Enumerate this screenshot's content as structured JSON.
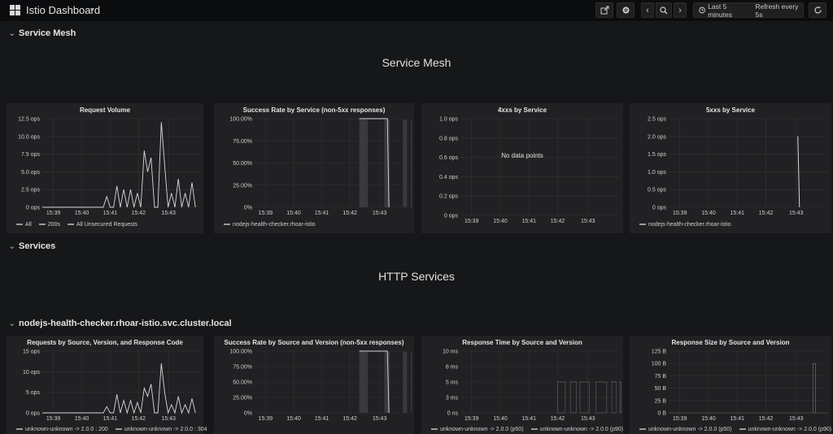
{
  "header": {
    "title": "Istio Dashboard",
    "time_range": "Last 5 minutes",
    "refresh": "Refresh every 5s"
  },
  "rows": [
    {
      "label": "Service Mesh"
    },
    {
      "label": "Services"
    },
    {
      "label": "nodejs-health-checker.rhoar-istio.svc.cluster.local"
    }
  ],
  "sections": {
    "service_mesh_title": "Service Mesh",
    "http_services_title": "HTTP Services"
  },
  "panels": [
    {
      "title": "Request Volume",
      "legend": [
        "All",
        "200s",
        "All Unsecured Requests"
      ]
    },
    {
      "title": "Success Rate by Service (non-5xx responses)",
      "legend": [
        "nodejs-health-checker.rhoar-istio"
      ]
    },
    {
      "title": "4xxs by Service",
      "legend": [],
      "message": "No data points"
    },
    {
      "title": "5xxs by Service",
      "legend": [
        "nodejs-health-checker.rhoar-istio"
      ]
    },
    {
      "title": "Requests by Source, Version, and Response Code",
      "legend": [
        "unknown-unknown -> 2.0.0 : 200",
        "unknown-unknown -> 2.0.0 : 304"
      ]
    },
    {
      "title": "Success Rate by Source and Version (non-5xx responses)",
      "legend": []
    },
    {
      "title": "Response Time by Source and Version",
      "legend": [
        "unknown-unknown -> 2.0.0 (p50)",
        "unknown-unknown -> 2.0.0 (p90)"
      ]
    },
    {
      "title": "Response Size by Source and Version",
      "legend": [
        "unknown-unknown -> 2.0.0 (p50)",
        "unknown-unknown -> 2.0.0 (p90)"
      ]
    }
  ],
  "chart_data": [
    {
      "type": "line",
      "title": "Request Volume",
      "x": [
        "15:39",
        "15:40",
        "15:41",
        "15:42",
        "15:43"
      ],
      "yticks": [
        "0 ops",
        "2.5 ops",
        "5.0 ops",
        "7.5 ops",
        "10.0 ops",
        "12.5 ops"
      ],
      "ylim": [
        0,
        12.5
      ],
      "series": [
        {
          "name": "All",
          "values": [
            0,
            0,
            0,
            0,
            0,
            1.5,
            0,
            0,
            3,
            0,
            2.5,
            0,
            2.5,
            0,
            2,
            0,
            8,
            5,
            7,
            0,
            0,
            12,
            6,
            0,
            2,
            0,
            4,
            0,
            2,
            0,
            3.5,
            0
          ]
        }
      ]
    },
    {
      "type": "line",
      "title": "Success Rate by Service (non-5xx responses)",
      "x": [
        "15:39",
        "15:40",
        "15:41",
        "15:42",
        "15:43"
      ],
      "yticks": [
        "0%",
        "25.00%",
        "50.00%",
        "75.00%",
        "100.00%"
      ],
      "ylim": [
        0,
        100
      ],
      "series": [
        {
          "name": "nodejs-health-checker.rhoar-istio",
          "values": [
            100,
            100,
            100,
            100,
            100,
            100,
            0
          ]
        }
      ]
    },
    {
      "type": "line",
      "title": "4xxs by Service",
      "x": [
        "15:39",
        "15:40",
        "15:41",
        "15:42",
        "15:43"
      ],
      "yticks": [
        "0 ops",
        "0.2 ops",
        "0.4 ops",
        "0.6 ops",
        "0.8 ops",
        "1.0 ops"
      ],
      "ylim": [
        0,
        1
      ],
      "series": []
    },
    {
      "type": "line",
      "title": "5xxs by Service",
      "x": [
        "15:39",
        "15:40",
        "15:41",
        "15:42",
        "15:43"
      ],
      "yticks": [
        "0 ops",
        "0.5 ops",
        "1.0 ops",
        "1.5 ops",
        "2.0 ops",
        "2.5 ops"
      ],
      "ylim": [
        0,
        2.5
      ],
      "series": [
        {
          "name": "nodejs-health-checker.rhoar-istio",
          "values": [
            2,
            0
          ]
        }
      ]
    },
    {
      "type": "line",
      "title": "Requests by Source, Version, and Response Code",
      "x": [
        "15:39",
        "15:40",
        "15:41",
        "15:42",
        "15:43"
      ],
      "yticks": [
        "0 ops",
        "5 ops",
        "10 ops",
        "15 ops"
      ],
      "ylim": [
        0,
        15
      ],
      "series": [
        {
          "name": "unknown-unknown -> 2.0.0 : 200",
          "values": [
            0,
            0,
            0,
            0,
            0,
            1.5,
            0,
            0,
            4.5,
            0,
            3,
            0,
            3,
            0,
            2.5,
            0,
            6,
            4,
            7,
            0,
            0,
            12,
            5,
            0,
            2,
            0,
            4,
            0,
            2,
            0,
            3.5,
            0
          ]
        },
        {
          "name": "unknown-unknown -> 2.0.0 : 304",
          "values": []
        }
      ]
    },
    {
      "type": "line",
      "title": "Success Rate by Source and Version (non-5xx responses)",
      "x": [
        "15:39",
        "15:40",
        "15:41",
        "15:42",
        "15:43"
      ],
      "yticks": [
        "0%",
        "25.00%",
        "50.00%",
        "75.00%",
        "100.00%"
      ],
      "ylim": [
        0,
        100
      ],
      "series": [
        {
          "name": "",
          "values": [
            100,
            100,
            100,
            100,
            100,
            100,
            0
          ]
        }
      ]
    },
    {
      "type": "line",
      "title": "Response Time by Source and Version",
      "x": [
        "15:39",
        "15:40",
        "15:41",
        "15:42",
        "15:43"
      ],
      "yticks": [
        "0 ns",
        "3 ms",
        "5 ms",
        "8 ms",
        "10 ms"
      ],
      "ylim": [
        0,
        10
      ],
      "series": [
        {
          "name": "unknown-unknown -> 2.0.0 (p50)",
          "values": [
            5,
            5,
            5,
            5,
            5,
            5
          ]
        },
        {
          "name": "unknown-unknown -> 2.0.0 (p90)",
          "values": [
            5,
            5,
            5,
            5,
            5,
            5
          ]
        }
      ]
    },
    {
      "type": "line",
      "title": "Response Size by Source and Version",
      "x": [
        "15:39",
        "15:40",
        "15:41",
        "15:42",
        "15:43"
      ],
      "yticks": [
        "0 B",
        "25 B",
        "50 B",
        "75 B",
        "100 B",
        "125 B"
      ],
      "ylim": [
        0,
        125
      ],
      "series": [
        {
          "name": "unknown-unknown -> 2.0.0 (p50)",
          "values": [
            0,
            0,
            0,
            0,
            100,
            0
          ]
        },
        {
          "name": "unknown-unknown -> 2.0.0 (p90)",
          "values": [
            0,
            0,
            0,
            0,
            100,
            0
          ]
        }
      ]
    }
  ],
  "colors": {
    "page_bg": "#161719",
    "panel_bg": "#212124",
    "series": "#d8d9da",
    "grid": "#333333"
  }
}
